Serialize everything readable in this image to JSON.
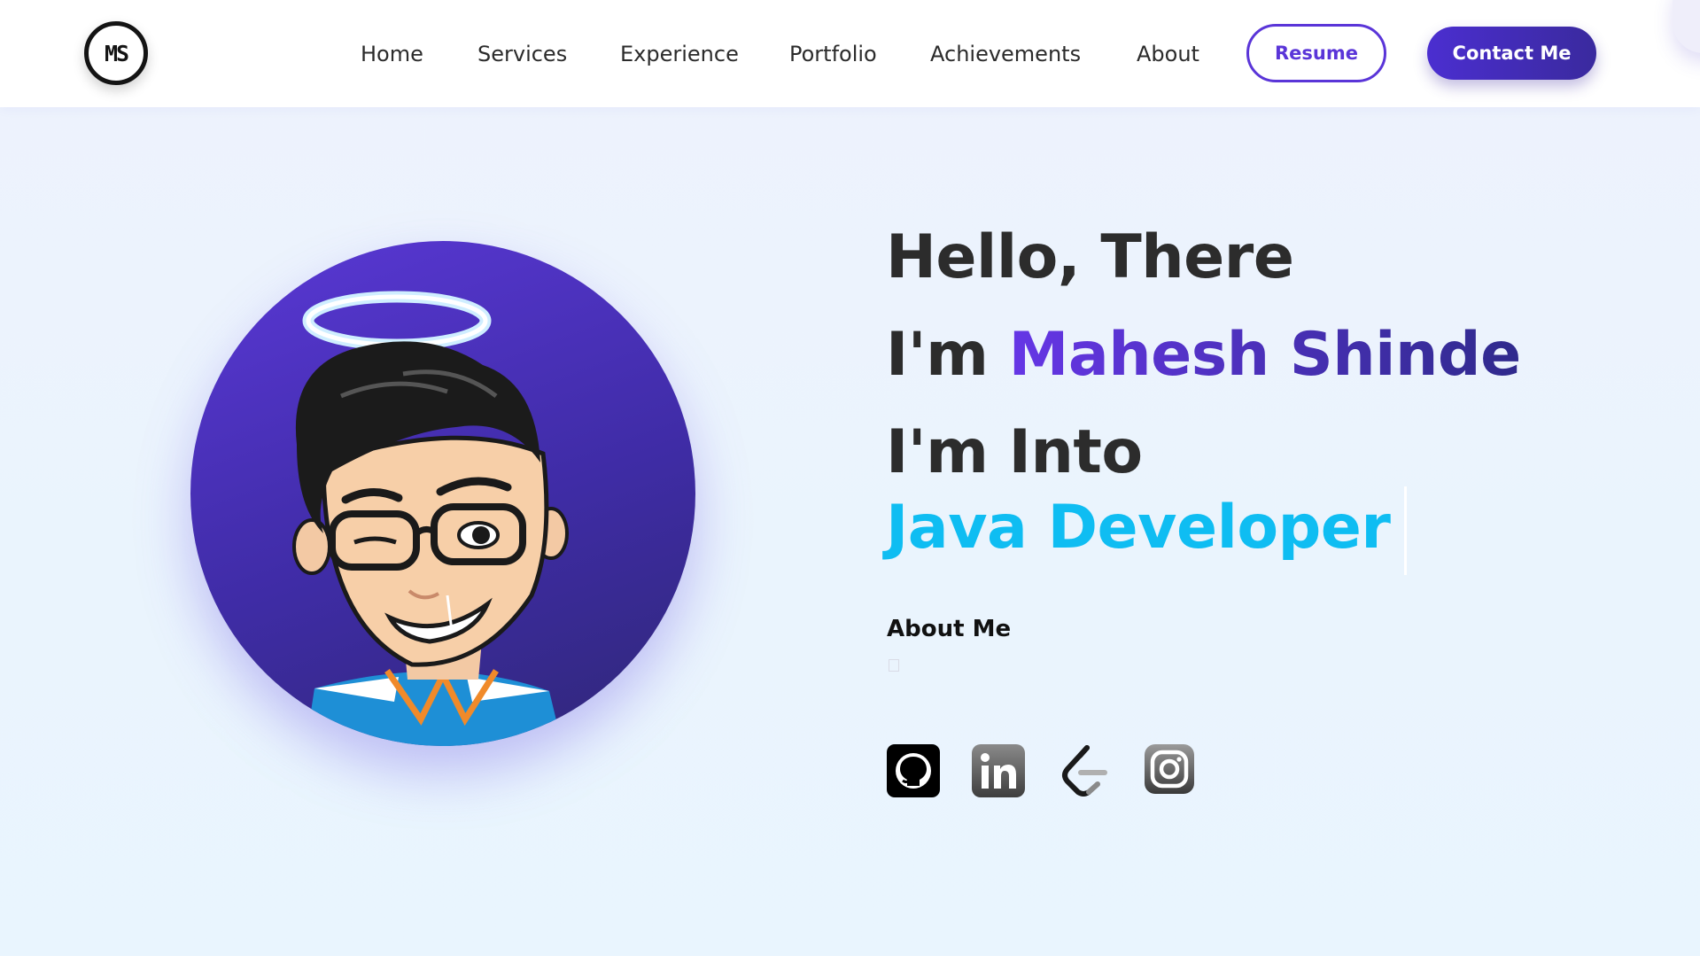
{
  "header": {
    "logo_text": "MS",
    "nav": [
      {
        "label": "Home"
      },
      {
        "label": "Services"
      },
      {
        "label": "Experience"
      },
      {
        "label": "Portfolio"
      },
      {
        "label": "Achievements"
      },
      {
        "label": "About"
      }
    ],
    "resume_label": "Resume",
    "contact_label": "Contact Me"
  },
  "hero": {
    "greeting": "Hello, There",
    "intro_prefix": "I'm ",
    "name": "Mahesh Shinde",
    "into": "I'm Into",
    "role": "Java Developer",
    "about_title": "About Me"
  },
  "socials": [
    {
      "icon": "github-icon"
    },
    {
      "icon": "linkedin-icon"
    },
    {
      "icon": "leetcode-icon"
    },
    {
      "icon": "instagram-icon"
    }
  ],
  "colors": {
    "accent": "#5a35d8",
    "name_gradient_start": "#6636e6",
    "name_gradient_end": "#2f2a8c",
    "role": "#0fbdf2",
    "background": "#eaf2fd"
  }
}
